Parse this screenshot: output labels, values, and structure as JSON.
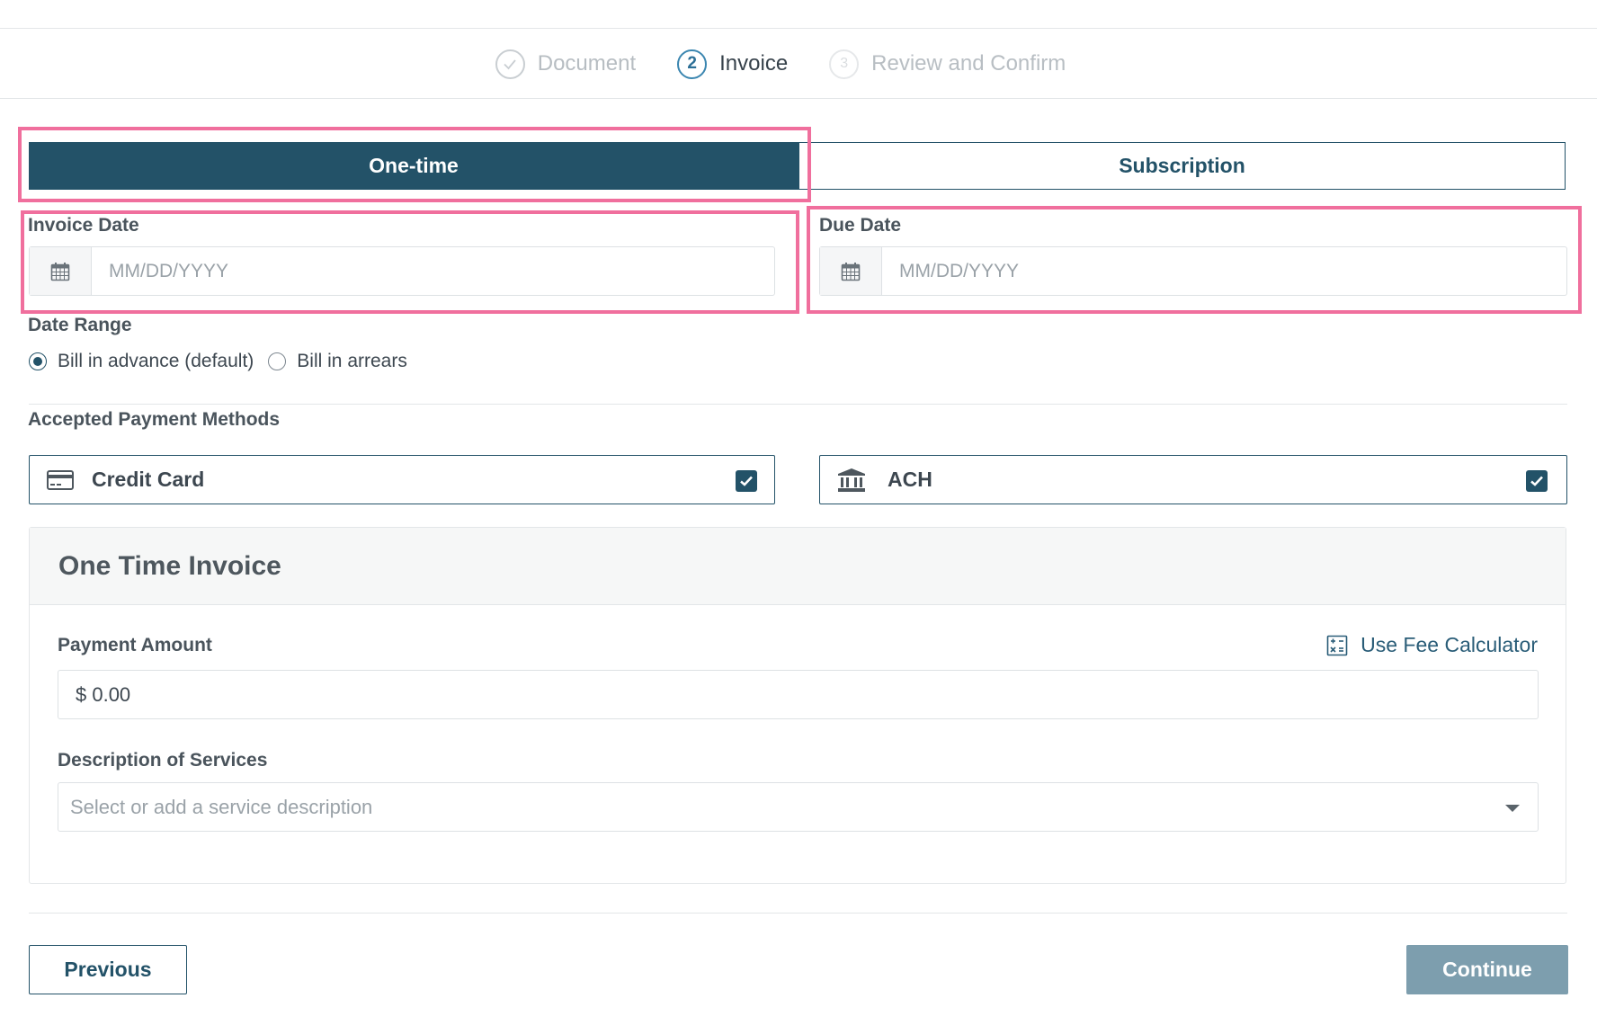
{
  "stepper": {
    "steps": [
      {
        "number": "✓",
        "label": "Document",
        "state": "done"
      },
      {
        "number": "2",
        "label": "Invoice",
        "state": "active"
      },
      {
        "number": "3",
        "label": "Review and Confirm",
        "state": "pending"
      }
    ]
  },
  "invoice_type": {
    "tabs": [
      {
        "label": "One-time",
        "selected": true
      },
      {
        "label": "Subscription",
        "selected": false
      }
    ]
  },
  "invoice_date": {
    "label": "Invoice Date",
    "placeholder": "MM/DD/YYYY",
    "icon": "calendar-icon"
  },
  "due_date": {
    "label": "Due Date",
    "placeholder": "MM/DD/YYYY",
    "icon": "calendar-icon"
  },
  "date_range": {
    "label": "Date Range",
    "options": [
      {
        "label": "Bill in advance (default)",
        "checked": true
      },
      {
        "label": "Bill in arrears",
        "checked": false
      }
    ]
  },
  "payment_methods": {
    "label": "Accepted Payment Methods",
    "methods": [
      {
        "label": "Credit Card",
        "icon": "credit-card-icon",
        "checked": true
      },
      {
        "label": "ACH",
        "icon": "bank-icon",
        "checked": true
      }
    ]
  },
  "one_time_invoice": {
    "title": "One Time Invoice",
    "payment_amount": {
      "label": "Payment Amount",
      "value": "$ 0.00"
    },
    "fee_calculator": {
      "label": "Use Fee Calculator",
      "icon": "calculator-icon"
    },
    "description": {
      "label": "Description of Services",
      "placeholder": "Select or add a service description"
    }
  },
  "actions": {
    "previous": "Previous",
    "continue": "Continue"
  },
  "colors": {
    "primary": "#235268",
    "highlight": "#f06f9d",
    "continue_disabled": "#7d9eae"
  }
}
